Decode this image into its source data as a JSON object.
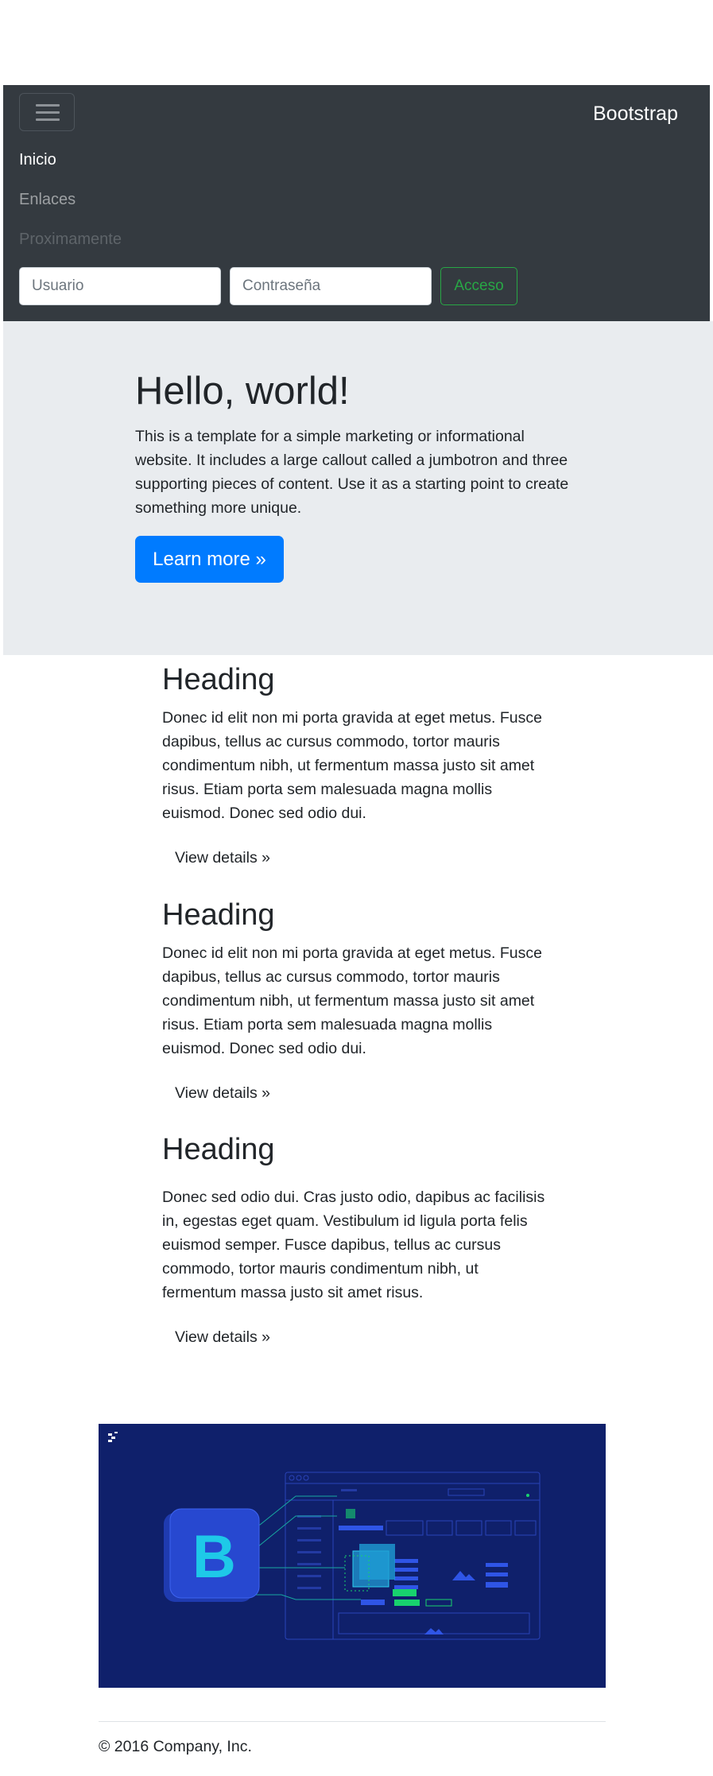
{
  "navbar": {
    "brand": "Bootstrap",
    "links": [
      {
        "label": "Inicio",
        "state": "active"
      },
      {
        "label": "Enlaces",
        "state": "normal"
      },
      {
        "label": "Proximamente",
        "state": "disabled"
      }
    ],
    "username_placeholder": "Usuario",
    "password_placeholder": "Contraseña",
    "submit_label": "Acceso",
    "colors": {
      "background": "#343a40",
      "success": "#28a745"
    }
  },
  "jumbotron": {
    "title": "Hello, world!",
    "text": "This is a template for a simple marketing or informational website. It includes a large callout called a jumbotron and three supporting pieces of content. Use it as a starting point to create something more unique.",
    "button": "Learn more »",
    "colors": {
      "background": "#e9ecef",
      "primary": "#007bff"
    }
  },
  "columns": [
    {
      "heading": "Heading",
      "text": "Donec id elit non mi porta gravida at eget metus. Fusce dapibus, tellus ac cursus commodo, tortor mauris condimentum nibh, ut fermentum massa justo sit amet risus. Etiam porta sem malesuada magna mollis euismod. Donec sed odio dui.",
      "button": "View details »"
    },
    {
      "heading": "Heading",
      "text": "Donec id elit non mi porta gravida at eget metus. Fusce dapibus, tellus ac cursus commodo, tortor mauris condimentum nibh, ut fermentum massa justo sit amet risus. Etiam porta sem malesuada magna mollis euismod. Donec sed odio dui.",
      "button": "View details »"
    },
    {
      "heading": "Heading",
      "text": "Donec sed odio dui. Cras justo odio, dapibus ac facilisis in, egestas eget quam. Vestibulum id ligula porta felis euismod semper. Fusce dapibus, tellus ac cursus commodo, tortor mauris condimentum nibh, ut fermentum massa justo sit amet risus.",
      "button": "View details »"
    }
  ],
  "hero_image": {
    "logo_letter": "B",
    "colors": {
      "background": "#0f206b",
      "accent": "#1ec9e8",
      "green": "#18d26e"
    }
  },
  "footer": {
    "text": "© 2016 Company, Inc."
  }
}
